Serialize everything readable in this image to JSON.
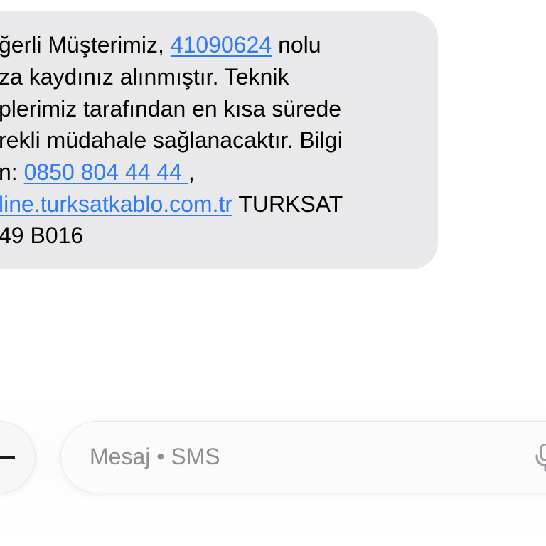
{
  "message": {
    "lines": [
      {
        "pre": "ğerli Müşterimiz, ",
        "link": "41090624",
        "post": " nolu"
      },
      {
        "pre": "za kaydınız alınmıştır. Teknik",
        "link": "",
        "post": ""
      },
      {
        "pre": "plerimiz tarafından en kısa sürede",
        "link": "",
        "post": ""
      },
      {
        "pre": "rekli müdahale sağlanacaktır. Bilgi",
        "link": "",
        "post": ""
      },
      {
        "pre": "n: ",
        "link": "0850 804 44 44 ",
        "post": ","
      },
      {
        "pre": "",
        "link": "line.turksatkablo.com.tr",
        "post": " TURKSAT"
      },
      {
        "pre": "49 B016",
        "link": "",
        "post": ""
      }
    ]
  },
  "composer": {
    "placeholder": "Mesaj • SMS",
    "add_icon": "plus-icon",
    "mic_icon": "microphone-icon"
  },
  "colors": {
    "bubble": "#e9e9eb",
    "link": "#2f7cf6",
    "placeholder": "#8e8e93"
  }
}
